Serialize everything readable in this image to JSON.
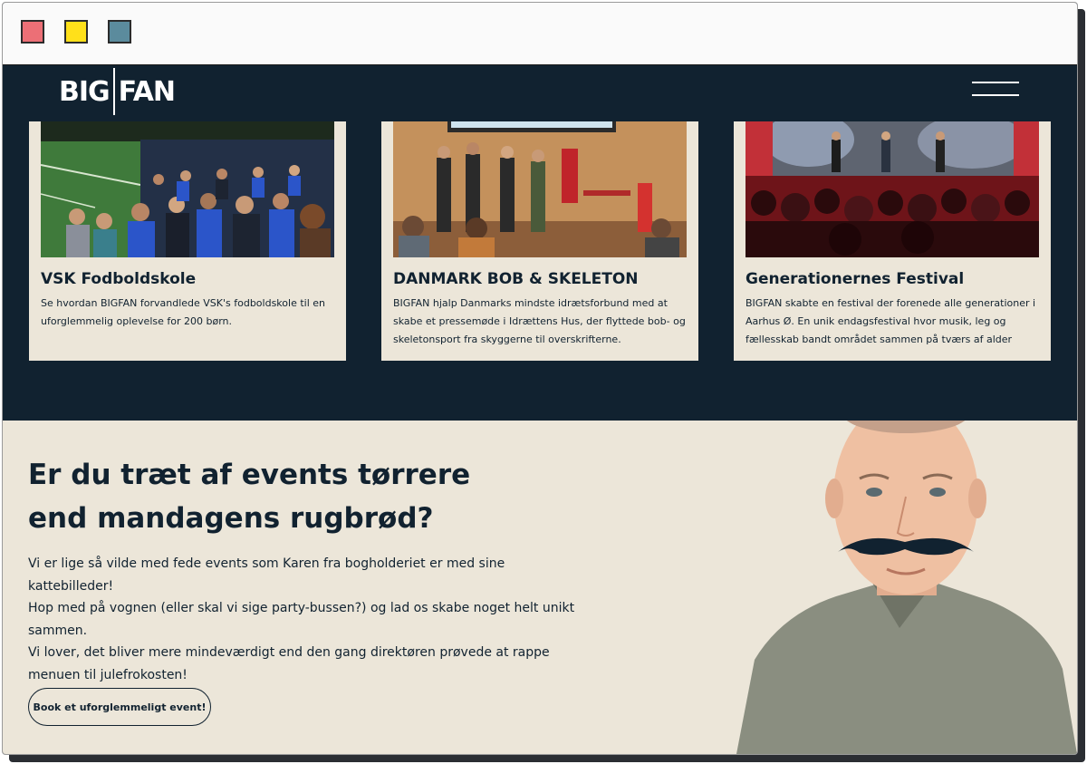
{
  "brand": {
    "logo_left": "BIG",
    "logo_right": "FAN"
  },
  "nav": {
    "menu_icon": "hamburger-menu-icon"
  },
  "cards": [
    {
      "title": "VSK Fodboldskole",
      "text": "Se hvordan BIGFAN forvandlede VSK's fodboldskole til en uforglemmelig oplevelse for 200 børn."
    },
    {
      "title": "DANMARK BOB & SKELETON",
      "text": "BIGFAN hjalp Danmarks mindste idrætsforbund med at skabe et pressemøde i Idrættens Hus, der flyttede bob- og skeletonsport fra skyggerne til overskrifterne."
    },
    {
      "title": "Generationernes Festival",
      "text": "BIGFAN skabte en festival der forenede alle generationer i Aarhus Ø. En unik endagsfestival hvor musik, leg og fællesskab bandt området sammen på tværs af alder"
    }
  ],
  "hero": {
    "headline_line1": "Er du træt af events tørrere",
    "headline_line2": "end mandagens rugbrød?",
    "paragraph1": "Vi er lige så vilde med fede events som Karen fra bogholderiet er med sine kattebilleder!",
    "paragraph2": "Hop med på vognen (eller skal vi sige party-bussen?) og lad os skabe noget helt unikt sammen.",
    "paragraph3": "Vi lover, det bliver mere mindeværdigt end den gang direktøren prøvede at rappe menuen til julefrokosten!",
    "cta_label": "Book et uforglemmeligt event!"
  },
  "colors": {
    "navy": "#112230",
    "cream": "#ece6d9",
    "window_dot_red": "#ec6f76",
    "window_dot_yellow": "#ffe01a",
    "window_dot_teal": "#5b8b9d"
  }
}
